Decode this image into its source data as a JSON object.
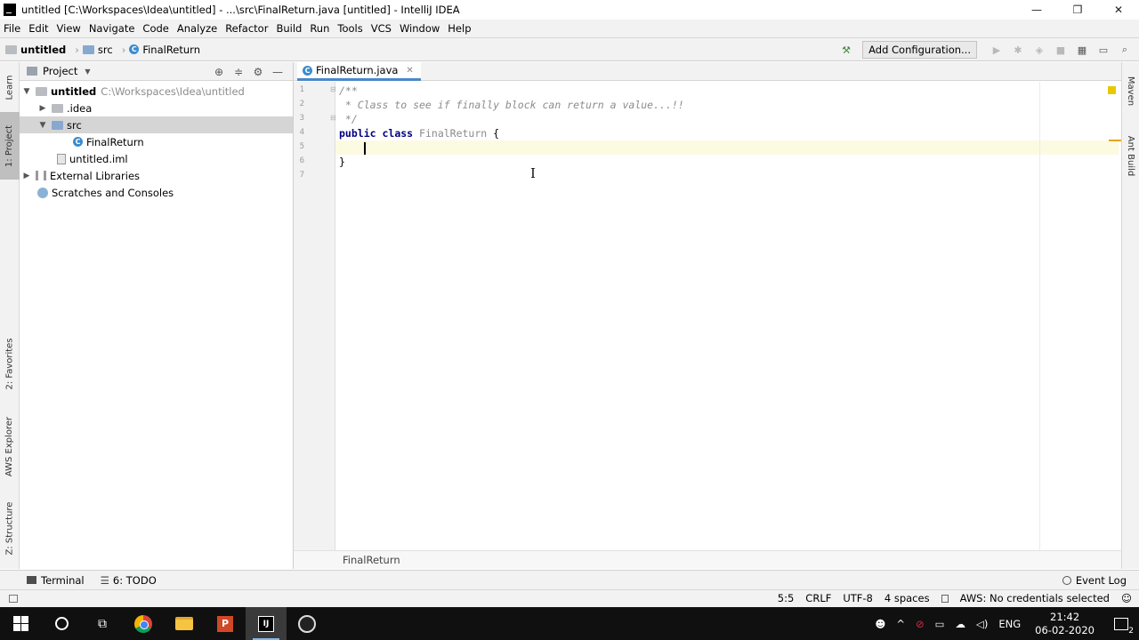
{
  "window": {
    "title": "untitled [C:\\Workspaces\\Idea\\untitled] - ...\\src\\FinalReturn.java [untitled] - IntelliJ IDEA",
    "controls": [
      "—",
      "❐",
      "✕"
    ]
  },
  "menu": [
    "File",
    "Edit",
    "View",
    "Navigate",
    "Code",
    "Analyze",
    "Refactor",
    "Build",
    "Run",
    "Tools",
    "VCS",
    "Window",
    "Help"
  ],
  "navbar": {
    "crumbs": [
      "untitled",
      "src",
      "FinalReturn"
    ],
    "add_configuration": "Add Configuration..."
  },
  "left_tool_tabs": [
    "Learn",
    "1: Project",
    "2: Favorites",
    "AWS Explorer",
    "Z: Structure"
  ],
  "right_tool_tabs": [
    "Maven",
    "Ant Build"
  ],
  "project_panel": {
    "title": "Project",
    "tree": [
      {
        "label": "untitled",
        "path": "C:\\Workspaces\\Idea\\untitled",
        "expanded": true
      },
      {
        "label": ".idea",
        "expanded": false
      },
      {
        "label": "src",
        "expanded": true,
        "selected": true
      },
      {
        "label": "FinalReturn"
      },
      {
        "label": "untitled.iml"
      },
      {
        "label": "External Libraries",
        "expanded": false
      },
      {
        "label": "Scratches and Consoles"
      }
    ]
  },
  "editor": {
    "tab": "FinalReturn.java",
    "line_numbers": [
      "1",
      "2",
      "3",
      "4",
      "5",
      "6",
      "7"
    ],
    "lines": {
      "l1": "/**",
      "l2": " * Class to see if finally block can return a value...!!",
      "l3": " */",
      "l4_kw1": "public",
      "l4_kw2": "class",
      "l4_name": "FinalReturn",
      "l4_brace": "{",
      "l6": "}"
    },
    "breadcrumb": "FinalReturn"
  },
  "bottom_tabs": {
    "terminal": "Terminal",
    "todo": "6: TODO",
    "event_log": "Event Log"
  },
  "status": {
    "position": "5:5",
    "line_sep": "CRLF",
    "encoding": "UTF-8",
    "indent": "4 spaces",
    "aws": "AWS: No credentials selected"
  },
  "taskbar": {
    "lang": "ENG",
    "time": "21:42",
    "date": "06-02-2020",
    "notifications": "2"
  }
}
